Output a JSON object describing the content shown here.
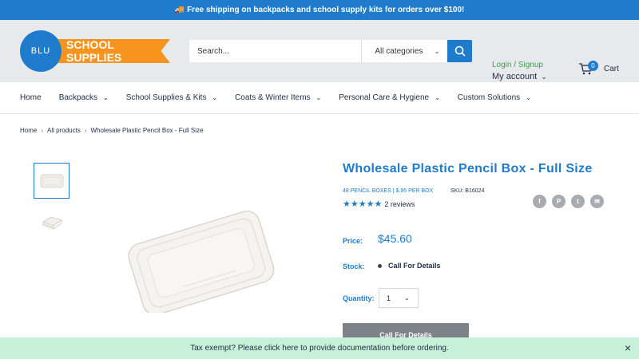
{
  "announcement": {
    "text": "Free shipping on backpacks and school supply kits for orders over $100!",
    "icon": "truck-icon"
  },
  "header": {
    "logo_circle": "BLU",
    "logo_banner": "SCHOOL SUPPLIES",
    "search_placeholder": "Search...",
    "category_select": "All categories",
    "login_link": "Login / Signup",
    "my_account": "My account",
    "cart_count": "0",
    "cart_label": "Cart"
  },
  "nav": {
    "items": [
      {
        "label": "Home",
        "has_dropdown": false
      },
      {
        "label": "Backpacks",
        "has_dropdown": true
      },
      {
        "label": "School Supplies & Kits",
        "has_dropdown": true
      },
      {
        "label": "Coats & Winter Items",
        "has_dropdown": true
      },
      {
        "label": "Personal Care & Hygiene",
        "has_dropdown": true
      },
      {
        "label": "Custom Solutions",
        "has_dropdown": true
      }
    ]
  },
  "breadcrumb": [
    "Home",
    "All products",
    "Wholesale Plastic Pencil Box - Full Size"
  ],
  "product": {
    "title": "Wholesale Plastic Pencil Box - Full Size",
    "pack_info": "48 PENCIL BOXES | $.95 PER BOX",
    "sku": "SKU: B16024",
    "rating_stars": 5,
    "reviews": "2 reviews",
    "price_label": "Price:",
    "price": "$45.60",
    "stock_label": "Stock:",
    "stock_value": "Call For Details",
    "quantity_label": "Quantity:",
    "quantity_value": "1",
    "cta_label": "Call For Details"
  },
  "share_icons": [
    "facebook-icon",
    "pinterest-icon",
    "twitter-icon",
    "email-icon"
  ],
  "tax_bar": {
    "text": "Tax exempt? Please click here to provide documentation before ordering.",
    "close": "×"
  },
  "colors": {
    "brand_blue": "#1f7ccc",
    "brand_orange": "#f7941d",
    "login_green": "#3aa04a",
    "tax_bar_bg": "#c7f0d9"
  }
}
